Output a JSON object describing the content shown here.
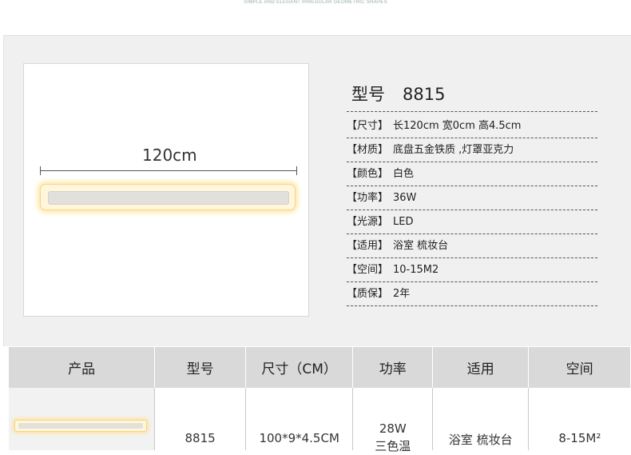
{
  "banner": {
    "tagline": "SIMPLE AND ELEGANT  IRREGULAR GEOMETRIC SHAPES"
  },
  "photo": {
    "dimension_label": "120cm"
  },
  "model": {
    "label": "型号",
    "number": "8815"
  },
  "specs": [
    {
      "key": "【尺寸】",
      "value": "长120cm 宽0cm 高4.5cm"
    },
    {
      "key": "【材质】",
      "value": "底盘五金铁质 ,灯罩亚克力"
    },
    {
      "key": "【颜色】",
      "value": "白色"
    },
    {
      "key": "【功率】",
      "value": "36W"
    },
    {
      "key": "【光源】",
      "value": "LED"
    },
    {
      "key": "【适用】",
      "value": "浴室 梳妆台"
    },
    {
      "key": "【空间】",
      "value": "10-15M2"
    },
    {
      "key": "【质保】",
      "value": "2年"
    }
  ],
  "table": {
    "headers": [
      "产品",
      "型号",
      "尺寸（CM）",
      "功率",
      "适用",
      "空间"
    ],
    "row": {
      "model": "8815",
      "size": "100*9*4.5CM",
      "power_line1": "28W",
      "power_line2": "三色温",
      "usage": "浴室 梳妆台",
      "space": "8-15M²"
    }
  },
  "colors": {
    "header_bg": "#d9d9d9",
    "panel_bg": "#f0f0f0",
    "lamp_glow": "#ffe8a8"
  }
}
